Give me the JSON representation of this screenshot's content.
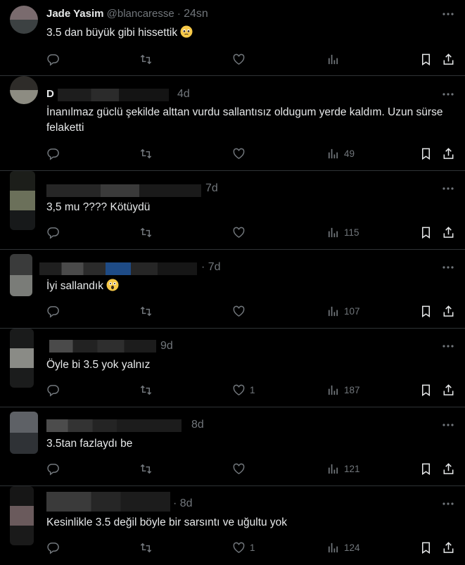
{
  "replies": [
    {
      "name": "Jade Yasim",
      "handle": "@blancaresse",
      "time": "24sn",
      "text": "3.5 dan büyük gibi hissettik",
      "emoji": "pleading-face",
      "views": "",
      "likes": ""
    },
    {
      "name": "D",
      "handle": "",
      "time": "4d",
      "text": "İnanılmaz güclü şekilde alttan vurdu sallantısız oldugum yerde kaldım. Uzun sürse felaketti",
      "emoji": "",
      "views": "49",
      "likes": ""
    },
    {
      "name": "",
      "handle": "",
      "time": "7d",
      "text": "3,5 mu ???? Kötüydü",
      "emoji": "",
      "views": "115",
      "likes": ""
    },
    {
      "name": "",
      "handle": "",
      "time": "· 7d",
      "text": "İyi sallandık",
      "emoji": "astonished-face",
      "views": "107",
      "likes": ""
    },
    {
      "name": "",
      "handle": "",
      "time": "9d",
      "text": "Öyle bi 3.5 yok yalnız",
      "emoji": "",
      "views": "187",
      "likes": "1"
    },
    {
      "name": "",
      "handle": "",
      "time": "8d",
      "text": "3.5tan fazlaydı be",
      "emoji": "",
      "views": "121",
      "likes": ""
    },
    {
      "name": "",
      "handle": "",
      "time": "· 8d",
      "text": "Kesinlikle 3.5 değil böyle bir sarsıntı ve uğultu yok",
      "emoji": "",
      "views": "124",
      "likes": "1"
    }
  ],
  "icons": [
    "reply-icon",
    "retweet-icon",
    "like-icon",
    "views-icon",
    "bookmark-icon",
    "share-icon",
    "more-icon"
  ],
  "colors": {
    "background": "#000000",
    "text": "#e7e9ea",
    "muted": "#71767b",
    "divider": "#2f3336"
  }
}
